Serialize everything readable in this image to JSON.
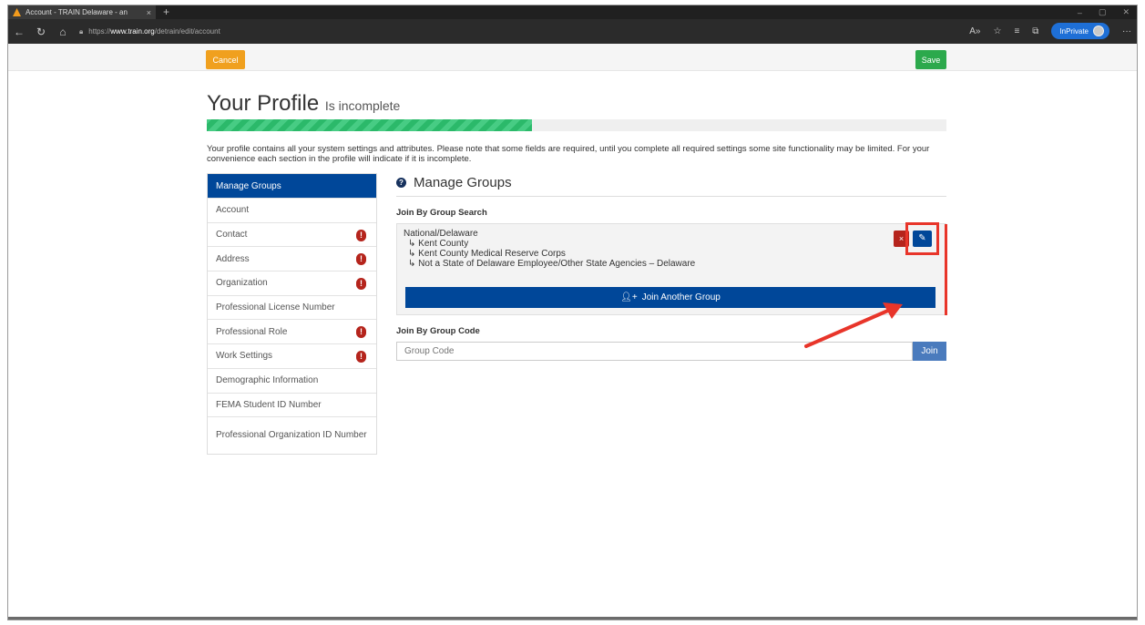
{
  "browser": {
    "tab_title": "Account - TRAIN Delaware - an",
    "tab_close": "×",
    "new_tab": "+",
    "url_scheme": "https://",
    "url_host": "www.train.org",
    "url_path": "/detrain/edit/account",
    "inprivate_label": "InPrivate",
    "more": "···",
    "win_min": "–",
    "win_max": "▢",
    "win_close": "✕"
  },
  "toolbar": {
    "cancel_label": "Cancel",
    "save_label": "Save"
  },
  "header": {
    "title": "Your Profile",
    "subtitle": "Is incomplete",
    "progress": 0.44
  },
  "description": "Your profile contains all your system settings and attributes. Please note that some fields are required, until you complete all required settings some site functionality may be limited. For your convenience each section in the profile will indicate if it is incomplete.",
  "sidebar": {
    "items": [
      {
        "label": "Manage Groups",
        "active": true,
        "warn": false
      },
      {
        "label": "Account",
        "warn": false
      },
      {
        "label": "Contact",
        "warn": true
      },
      {
        "label": "Address",
        "warn": true
      },
      {
        "label": "Organization",
        "warn": true
      },
      {
        "label": "Professional License Number",
        "warn": false
      },
      {
        "label": "Professional Role",
        "warn": true
      },
      {
        "label": "Work Settings",
        "warn": true
      },
      {
        "label": "Demographic Information",
        "warn": false
      },
      {
        "label": "FEMA Student ID Number",
        "warn": false
      },
      {
        "label": "Professional Organization ID Number",
        "warn": false
      }
    ],
    "warn_glyph": "!"
  },
  "main": {
    "section_title": "Manage Groups",
    "help_glyph": "?",
    "group_search_label": "Join By Group Search",
    "group_lines": [
      "National/Delaware",
      "↳ Kent County",
      "↳ Kent County Medical Reserve Corps",
      "↳ Not a State of Delaware Employee/Other State Agencies – Delaware"
    ],
    "delete_glyph": "×",
    "edit_glyph": "✎",
    "join_another_label": "Join Another Group",
    "group_code_label": "Join By Group Code",
    "group_code_placeholder": "Group Code",
    "join_label": "Join"
  },
  "colors": {
    "accent": "#004799",
    "warn": "#b5241c",
    "highlight": "#e8352a",
    "cancel": "#f0a01e",
    "save": "#2ca94c"
  }
}
